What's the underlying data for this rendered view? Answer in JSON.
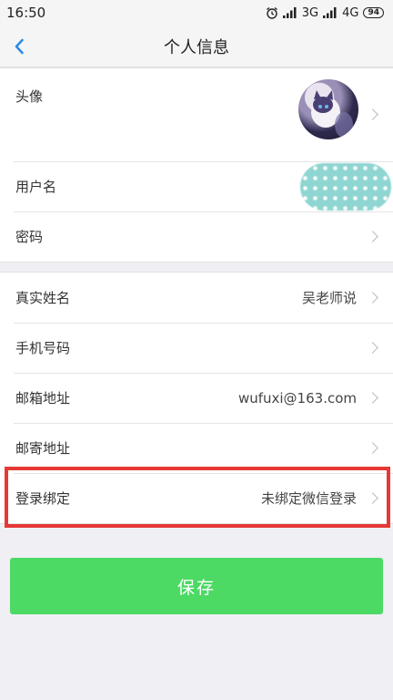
{
  "status_bar": {
    "time": "16:50",
    "network_3g": "3G",
    "network_4g": "4G",
    "battery": "94"
  },
  "nav": {
    "title": "个人信息"
  },
  "account_group": [
    {
      "label": "头像"
    },
    {
      "label": "用户名"
    },
    {
      "label": "密码"
    }
  ],
  "info_group": [
    {
      "label": "真实姓名",
      "value": "吴老师说"
    },
    {
      "label": "手机号码",
      "value": ""
    },
    {
      "label": "邮箱地址",
      "value": "wufuxi@163.com"
    },
    {
      "label": "邮寄地址",
      "value": ""
    },
    {
      "label": "登录绑定",
      "value": "未绑定微信登录"
    }
  ],
  "save_button": {
    "label": "保存"
  },
  "colors": {
    "accent_green": "#4cd964",
    "back_blue": "#2b8ce3",
    "highlight_red": "#e53935"
  },
  "icons": {
    "back": "chevron-left-icon",
    "row_arrow": "chevron-right-icon"
  }
}
